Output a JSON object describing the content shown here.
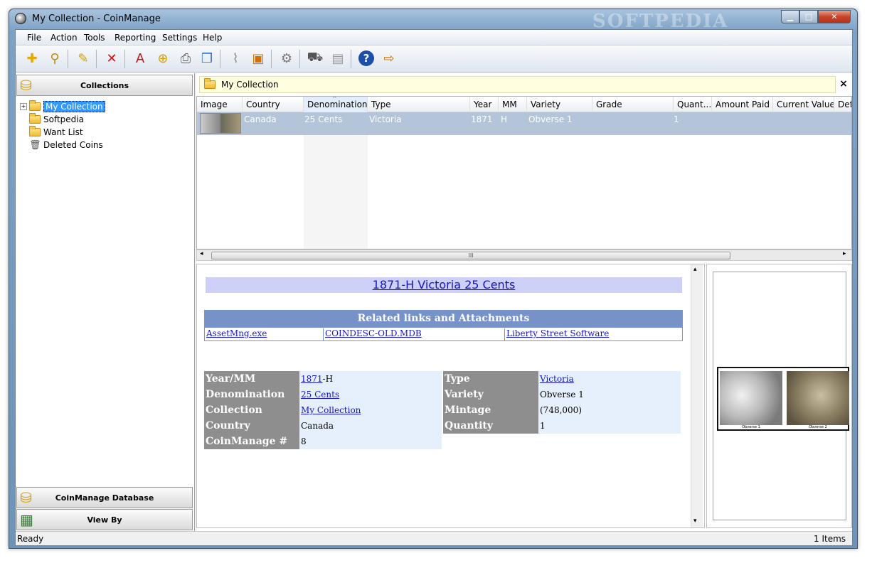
{
  "window": {
    "title": "My Collection - CoinManage",
    "watermark": "SOFTPEDIA"
  },
  "menu": [
    "File",
    "Action",
    "Tools",
    "Reporting",
    "Settings",
    "Help"
  ],
  "toolbar": [
    "add-coin",
    "find",
    "edit",
    "delete",
    "search",
    "add-coins",
    "print",
    "move",
    "attach",
    "add-image",
    "settings",
    "shopping",
    "export",
    "help",
    "exit"
  ],
  "left_panel": {
    "collections_header": "Collections",
    "tree": [
      {
        "label": "My Collection",
        "selected": true
      },
      {
        "label": "Softpedia"
      },
      {
        "label": "Want List"
      },
      {
        "label": "Deleted Coins"
      }
    ],
    "database_header": "CoinManage Database",
    "viewby_header": "View By"
  },
  "breadcrumb": {
    "label": "My Collection",
    "close": "×"
  },
  "grid": {
    "columns": [
      "Image",
      "Country",
      "Denomination",
      "Type",
      "Year",
      "MM",
      "Variety",
      "Grade",
      "Quant...",
      "Amount Paid",
      "Current Value",
      "Defe"
    ],
    "sort_indicator": "^",
    "rows": [
      {
        "country": "Canada",
        "denomination": "25 Cents",
        "type": "Victoria",
        "year": "1871",
        "mm": "H",
        "variety": "Obverse 1",
        "quantity": "1"
      }
    ],
    "scroll_grip": "III"
  },
  "details": {
    "title": "1871-H Victoria 25 Cents",
    "related_header": "Related links and Attachments",
    "links": [
      "AssetMng.exe",
      "COINDESC-OLD.MDB",
      "Liberty Street Software"
    ],
    "fields": {
      "year_label": "Year/MM",
      "year_value": "1871",
      "year_suffix": "-H",
      "denomination_label": "Denomination",
      "denomination_value": "25 Cents",
      "collection_label": "Collection",
      "collection_value": "My Collection",
      "country_label": "Country",
      "country_value": "Canada",
      "coinmanage_label": "CoinManage #",
      "coinmanage_value": "8",
      "type_label": "Type",
      "type_value": "Victoria",
      "variety_label": "Variety",
      "variety_value": "Obverse 1",
      "mintage_label": "Mintage",
      "mintage_value": "(748,000)",
      "quantity_label": "Quantity",
      "quantity_value": "1"
    }
  },
  "image_panel": {
    "pic1_label": "Obverse 1",
    "pic2_label": "Obverse 2"
  },
  "status": {
    "left": "Ready",
    "right": "1 Items"
  }
}
